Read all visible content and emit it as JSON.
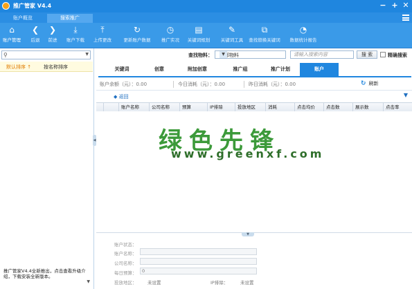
{
  "app": {
    "title": "推广管家 V4.4"
  },
  "window_controls": {
    "minimize": "−",
    "maximize": "+",
    "close": "✕"
  },
  "top_tabs": [
    {
      "label": "账户概览",
      "active": false
    },
    {
      "label": "搜索推广",
      "active": true
    }
  ],
  "toolbar": [
    {
      "label": "账户管理",
      "icon": "home-icon"
    },
    {
      "label": "后退",
      "icon": "back-icon"
    },
    {
      "label": "前进",
      "icon": "forward-icon"
    },
    {
      "label": "账户下载",
      "icon": "download-icon"
    },
    {
      "label": "上传更改",
      "icon": "upload-icon"
    },
    {
      "label": "更新账户数据",
      "icon": "refresh-icon"
    },
    {
      "label": "推广实况",
      "icon": "clock-icon"
    },
    {
      "label": "关键词规划",
      "icon": "chart-icon"
    },
    {
      "label": "关键词工具",
      "icon": "tool-icon"
    },
    {
      "label": "查找替换关键词",
      "icon": "replace-icon"
    },
    {
      "label": "数据统计报告",
      "icon": "pie-icon"
    }
  ],
  "left_panel": {
    "search_placeholder": "",
    "sort_by_default": "默认排序 ↑",
    "sort_by_name": "按名称排序",
    "notice": "推广管家V4.4全新推出，点击查看升级介绍，下载安装全新版本。"
  },
  "find_bar": {
    "label": "查找物料：",
    "scope": "全部物料",
    "keyword_placeholder": "请输入搜索内容",
    "search_button": "搜 索",
    "exact_label": "精确搜索"
  },
  "sub_tabs": [
    {
      "label": "关键词",
      "active": false
    },
    {
      "label": "创意",
      "active": false
    },
    {
      "label": "附加创意",
      "active": false
    },
    {
      "label": "推广组",
      "active": false
    },
    {
      "label": "推广计划",
      "active": false
    },
    {
      "label": "账户",
      "active": true
    }
  ],
  "balance": {
    "balance": "账户余额（元）：0.00",
    "today": "今日消耗（元）：0.00",
    "yesterday": "昨日消耗（元）：0.00",
    "refresh": "刷新"
  },
  "back_label": "◆ 返回",
  "grid_columns": [
    "账户名称",
    "公司名称",
    "预算",
    "IP排除",
    "投放地区",
    "消耗",
    "点击均价",
    "点击数",
    "展示数",
    "点击率"
  ],
  "watermark": {
    "cn": "绿色先锋",
    "url": "www.greenxf.com"
  },
  "account_info": {
    "status_label": "账户状态：",
    "name_label": "账户名称：",
    "company_label": "公司名称：",
    "budget_label": "每日预算：",
    "budget_value": "0",
    "region_label": "投放地区：",
    "region_value": "未设置",
    "ip_label": "IP排除：",
    "ip_value": "未设置"
  }
}
